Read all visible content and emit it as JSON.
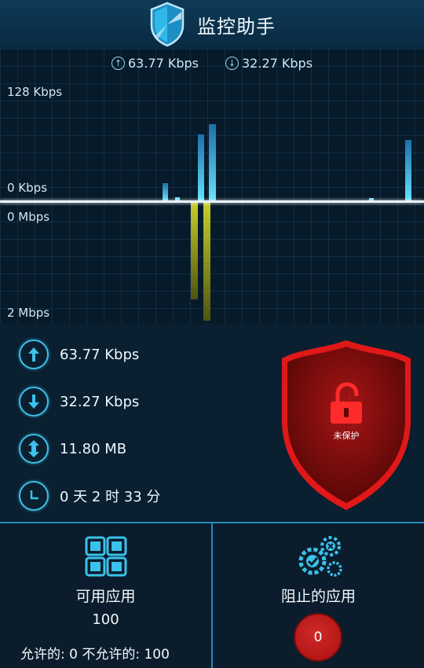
{
  "header": {
    "title": "监控助手",
    "icon": "shield-logo-icon"
  },
  "graph": {
    "upload_speed": "63.77 Kbps",
    "download_speed": "32.27 Kbps",
    "label_top": "128 Kbps",
    "label_zero_up": "0 Kbps",
    "label_zero_down": "0 Mbps",
    "label_bottom": "2 Mbps"
  },
  "stats": {
    "upload": "63.77 Kbps",
    "download": "32.27 Kbps",
    "total": "11.80 MB",
    "duration": "0 天 2 时 33 分"
  },
  "shield": {
    "status": "未保护",
    "icon": "unlocked-padlock-icon"
  },
  "panels": {
    "available": {
      "title": "可用应用",
      "count": "100",
      "allowed_summary": "允许的: 0 不允许的: 100",
      "icon": "apps-grid-icon"
    },
    "blocked": {
      "title": "阻止的应用",
      "count": "0",
      "icon": "gears-blocked-icon"
    }
  },
  "colors": {
    "accent": "#3bc1ea",
    "upload_bar": "#4fd3f0",
    "download_bar": "#b9c22a",
    "danger": "#c81818"
  }
}
